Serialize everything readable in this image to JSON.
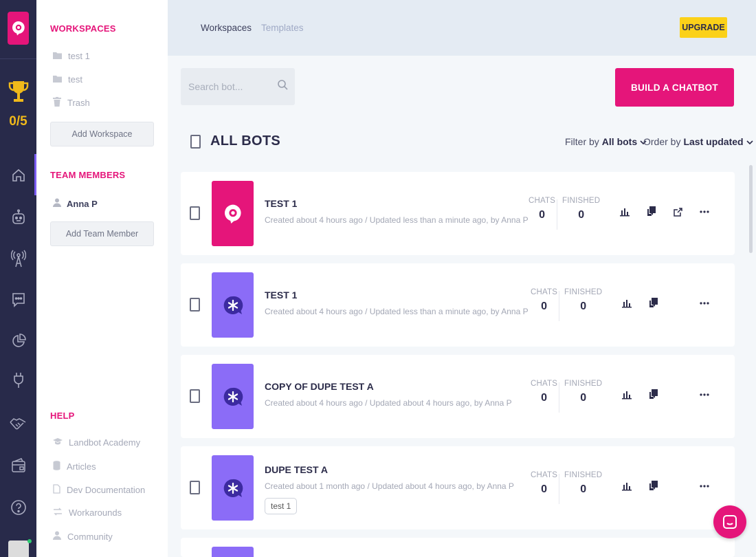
{
  "rail": {
    "trophy_count": "0/5",
    "icons": [
      "home-icon",
      "bot-icon",
      "broadcast-icon",
      "chat-icon",
      "analytics-icon",
      "integrations-icon",
      "partners-icon",
      "billing-icon",
      "help-icon"
    ]
  },
  "sidebar": {
    "workspaces_heading": "WORKSPACES",
    "workspaces": [
      {
        "label": "test 1",
        "icon": "folder-icon"
      },
      {
        "label": "test",
        "icon": "folder-icon"
      },
      {
        "label": "Trash",
        "icon": "trash-icon"
      }
    ],
    "add_workspace": "Add Workspace",
    "team_heading": "TEAM MEMBERS",
    "members": [
      {
        "label": "Anna P",
        "icon": "user-icon"
      }
    ],
    "add_member": "Add Team Member",
    "help_heading": "HELP",
    "help_items": [
      {
        "label": "Landbot Academy",
        "icon": "graduation-cap-icon"
      },
      {
        "label": "Articles",
        "icon": "articles-icon"
      },
      {
        "label": "Dev Documentation",
        "icon": "document-icon"
      },
      {
        "label": "Workarounds",
        "icon": "workarounds-icon"
      },
      {
        "label": "Community",
        "icon": "community-icon"
      }
    ]
  },
  "topbar": {
    "tabs": [
      {
        "label": "Workspaces",
        "active": true
      },
      {
        "label": "Templates",
        "active": false
      }
    ],
    "upgrade": "UPGRADE"
  },
  "main": {
    "search_placeholder": "Search bot...",
    "build_button": "BUILD A CHATBOT",
    "all_bots": "ALL BOTS",
    "filter_prefix": "Filter by",
    "filter_value": "All bots",
    "order_prefix": "Order by",
    "order_value": "Last updated",
    "chats_label": "CHATS",
    "finished_label": "FINISHED",
    "bots": [
      {
        "name": "TEST 1",
        "meta": "Created about 4 hours ago / Updated less than a minute ago, by Anna P",
        "chats": "0",
        "finished": "0",
        "thumb_color": "#e5157a",
        "thumb_icon": "landbot-logo-icon",
        "tag": "",
        "has_external_link": true
      },
      {
        "name": "TEST 1",
        "meta": "Created about 4 hours ago / Updated less than a minute ago, by Anna P",
        "chats": "0",
        "finished": "0",
        "thumb_color": "#8b6cf7",
        "thumb_icon": "asterisk-bubble-icon",
        "tag": "",
        "has_external_link": false
      },
      {
        "name": "COPY OF DUPE TEST A",
        "meta": "Created about 4 hours ago / Updated about 4 hours ago, by Anna P",
        "chats": "0",
        "finished": "0",
        "thumb_color": "#8b6cf7",
        "thumb_icon": "asterisk-bubble-icon",
        "tag": "",
        "has_external_link": false
      },
      {
        "name": "DUPE TEST A",
        "meta": "Created about 1 month ago / Updated about 4 hours ago, by Anna P",
        "chats": "0",
        "finished": "0",
        "thumb_color": "#8b6cf7",
        "thumb_icon": "asterisk-bubble-icon",
        "tag": "test 1",
        "has_external_link": false
      }
    ]
  },
  "colors": {
    "brand": "#e5157a",
    "accent_purple": "#8b6cf7",
    "upgrade": "#fbd119",
    "rail": "#282a4a"
  }
}
